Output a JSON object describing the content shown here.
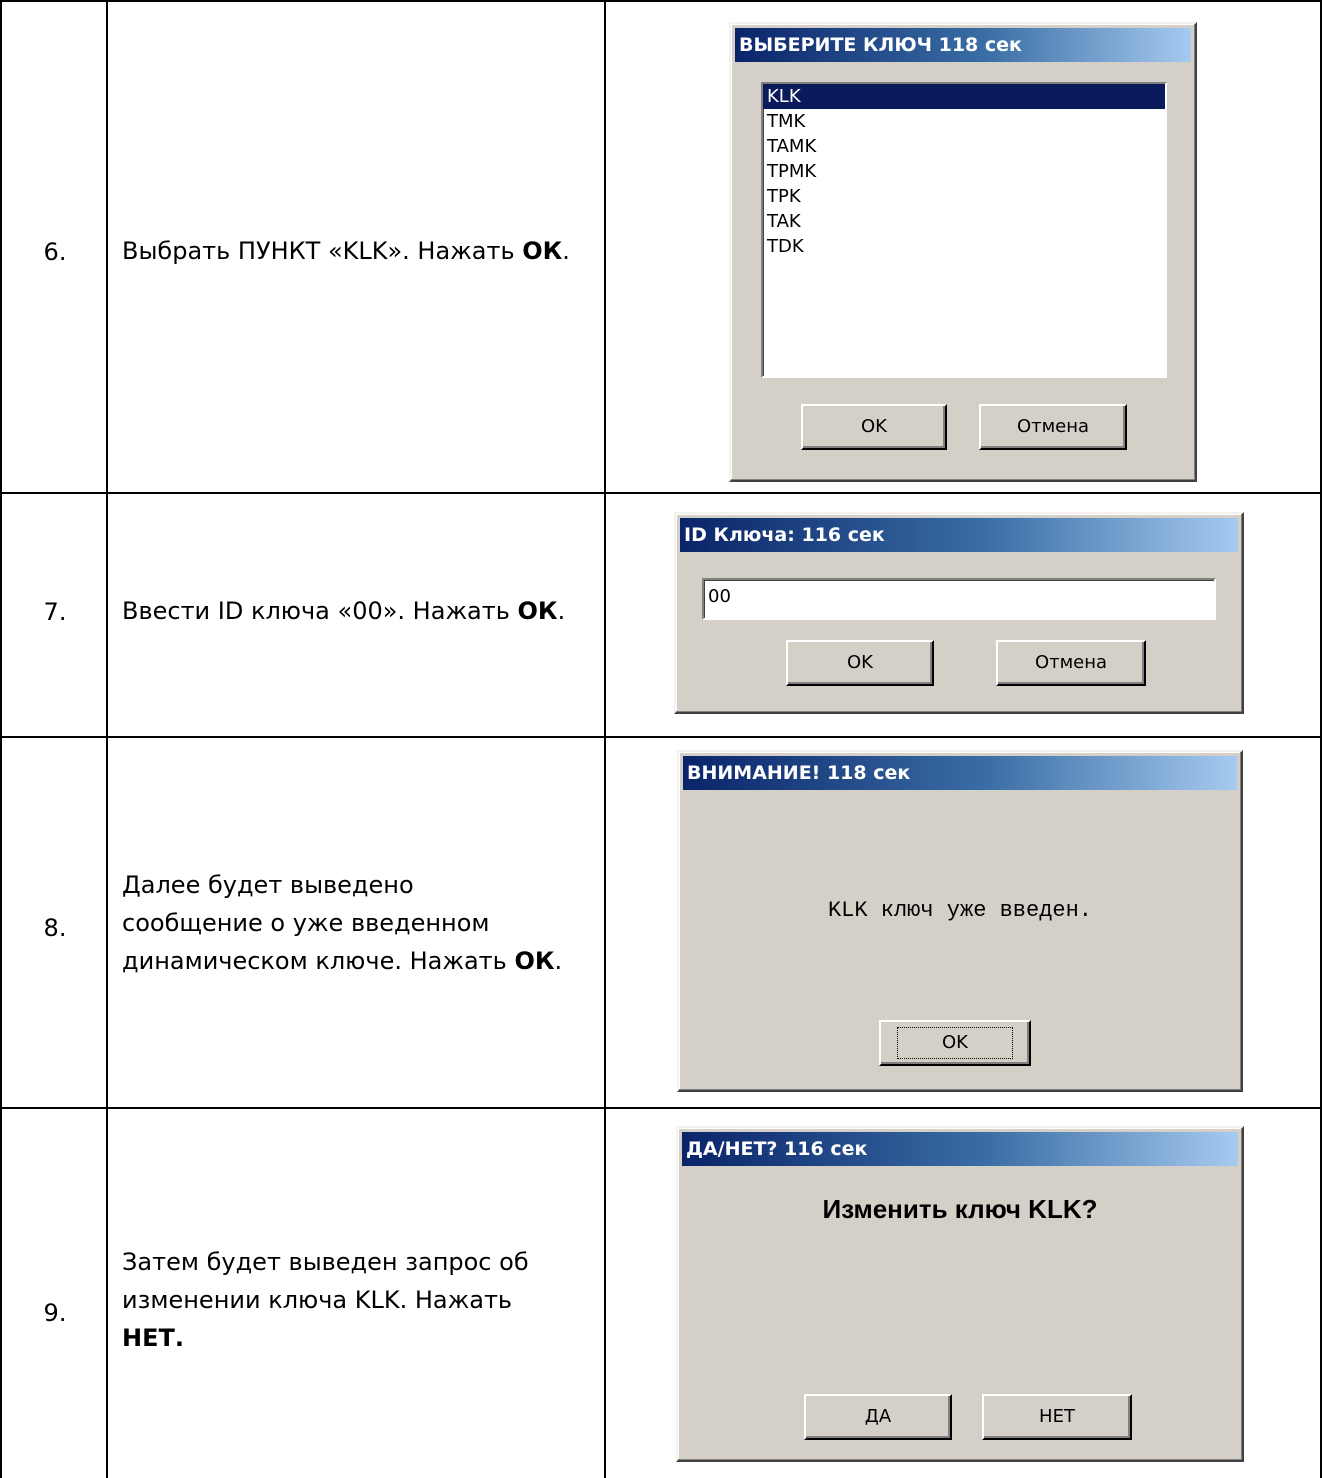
{
  "rows": [
    {
      "num": "6.",
      "text": "Выбрать ПУНКТ «KLK». Нажать ",
      "bold": "ОК",
      "tail": ".",
      "dialog": {
        "title": "ВЫБЕРИТЕ КЛЮЧ 118 сек",
        "items": [
          "KLK",
          "TMK",
          "TAMK",
          "TPMK",
          "TPK",
          "TAK",
          "TDK"
        ],
        "selected": "KLK",
        "ok": "OK",
        "cancel": "Отмена"
      }
    },
    {
      "num": "7.",
      "text": "Ввести ID ключа «00». Нажать ",
      "bold": "ОК",
      "tail": ".",
      "dialog": {
        "title": "ID Ключа: 116 сек",
        "input_value": "00",
        "ok": "OK",
        "cancel": "Отмена"
      }
    },
    {
      "num": "8.",
      "text_lines": [
        "Далее будет выведено",
        "сообщение о уже введенном",
        "динамическом ключе. Нажать "
      ],
      "bold": "ОК",
      "tail": ".",
      "dialog": {
        "title": "ВНИМАНИЕ! 118 сек",
        "message": "KLK ключ уже введен.",
        "ok": "OK"
      }
    },
    {
      "num": "9.",
      "text_lines": [
        "Затем будет выведен запрос об",
        "изменении ключа KLK. Нажать"
      ],
      "bold": "НЕТ.",
      "dialog": {
        "title": "ДА/НЕТ? 116 сек",
        "message": "Изменить ключ KLK?",
        "yes": "ДА",
        "no": "НЕТ"
      }
    }
  ],
  "colors": {
    "dialog_bg": "#d4d0c8",
    "titlebar_start": "#0a246a",
    "titlebar_end": "#a6caf0",
    "selection": "#0a1a5a"
  }
}
